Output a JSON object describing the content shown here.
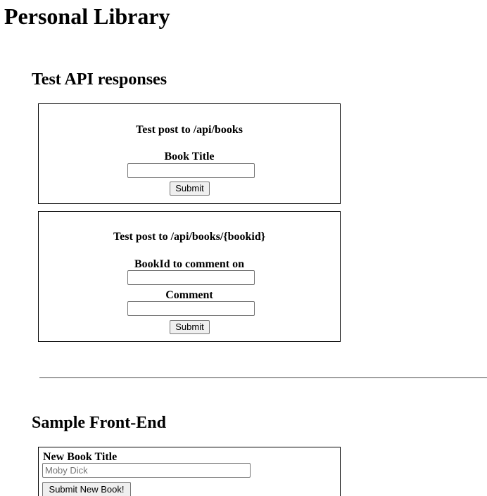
{
  "page": {
    "title": "Personal Library"
  },
  "test_section": {
    "heading": "Test API responses",
    "form_books": {
      "caption": "Test post to /api/books",
      "field_label": "Book Title",
      "field_value": "",
      "submit_label": "Submit"
    },
    "form_comment": {
      "caption": "Test post to /api/books/{bookid}",
      "id_label": "BookId to comment on",
      "id_value": "",
      "comment_label": "Comment",
      "comment_value": "",
      "submit_label": "Submit"
    }
  },
  "frontend_section": {
    "heading": "Sample Front-End",
    "new_book_label": "New Book Title",
    "new_book_placeholder": "Moby Dick",
    "submit_label": "Submit New Book!"
  }
}
